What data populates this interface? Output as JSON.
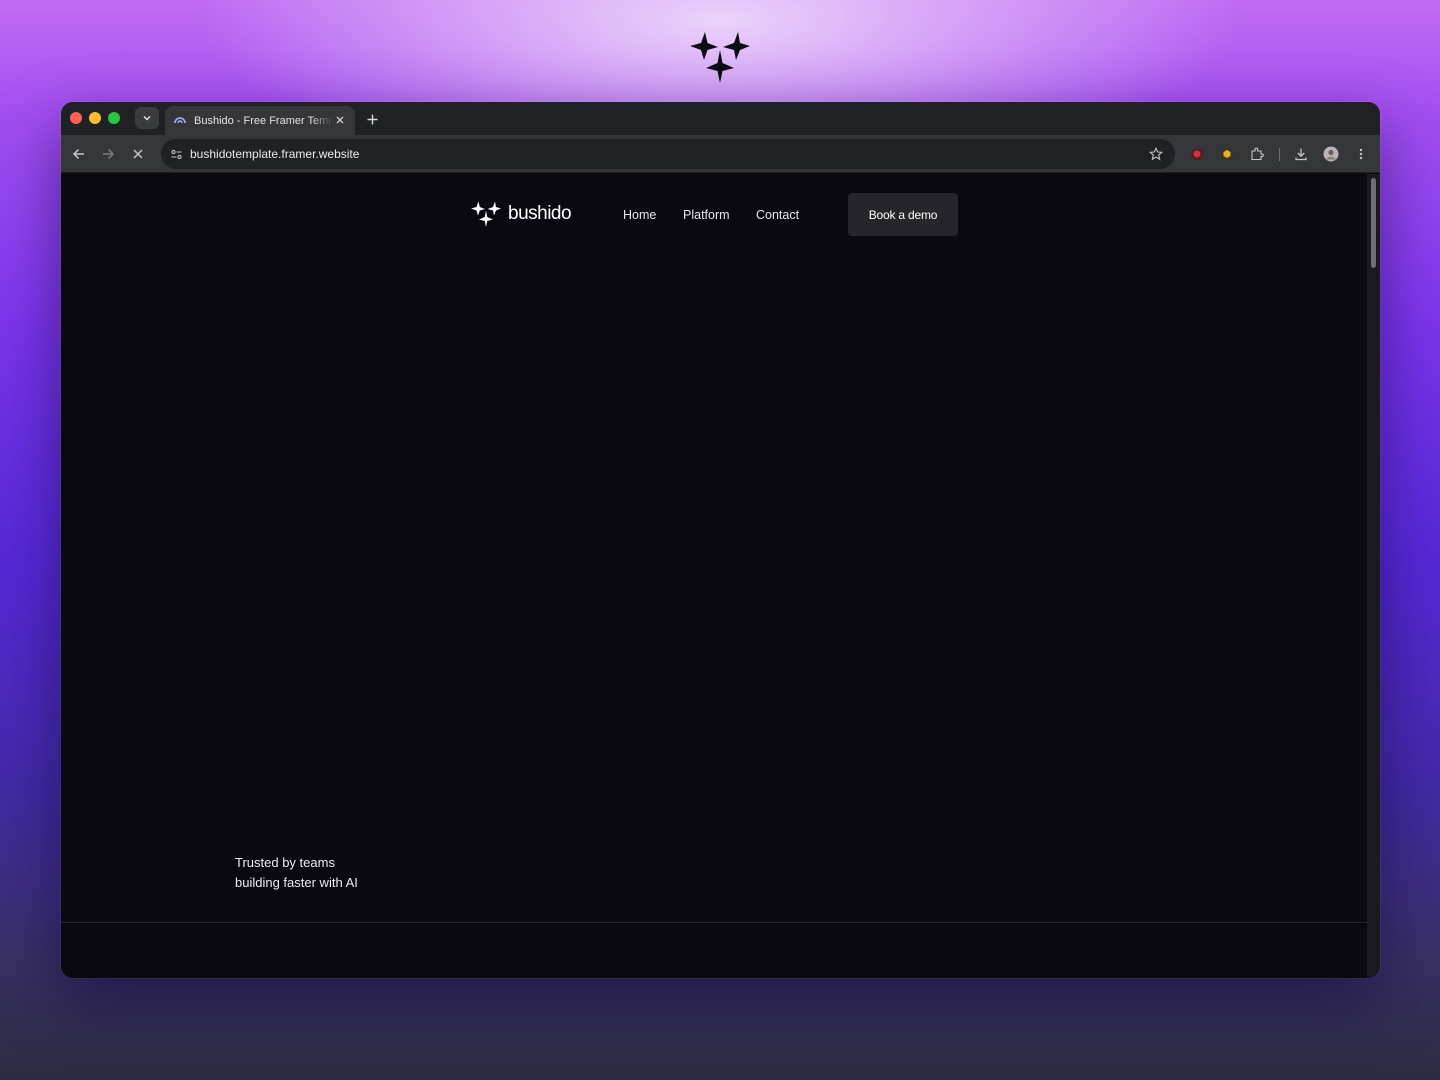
{
  "backdrop": {
    "logo_icon": "bushido-star-logo-icon"
  },
  "browser": {
    "tab": {
      "title": "Bushido - Free Framer Template",
      "favicon": "framer-icon"
    },
    "new_tab_symbol": "+",
    "address_bar": {
      "url": "bushidotemplate.framer.website"
    },
    "loading": true,
    "toolbar_icons": [
      "back-arrow-icon",
      "forward-arrow-icon",
      "stop-loading-icon",
      "site-info-icon",
      "bookmark-star-icon",
      "red-extension-icon",
      "yellow-extension-icon",
      "puzzle-extensions-icon",
      "download-icon",
      "profile-avatar-icon",
      "more-menu-icon"
    ]
  },
  "site": {
    "brand": {
      "name": "bushido"
    },
    "nav": {
      "home": "Home",
      "platform": "Platform",
      "contact": "Contact"
    },
    "cta": "Book a demo",
    "trusted": {
      "line1": "Trusted by teams",
      "line2": "building faster with AI"
    }
  },
  "colors": {
    "page_background": "#0a0912",
    "cta_background": "#26252b",
    "browser_chrome": "#35363a"
  }
}
